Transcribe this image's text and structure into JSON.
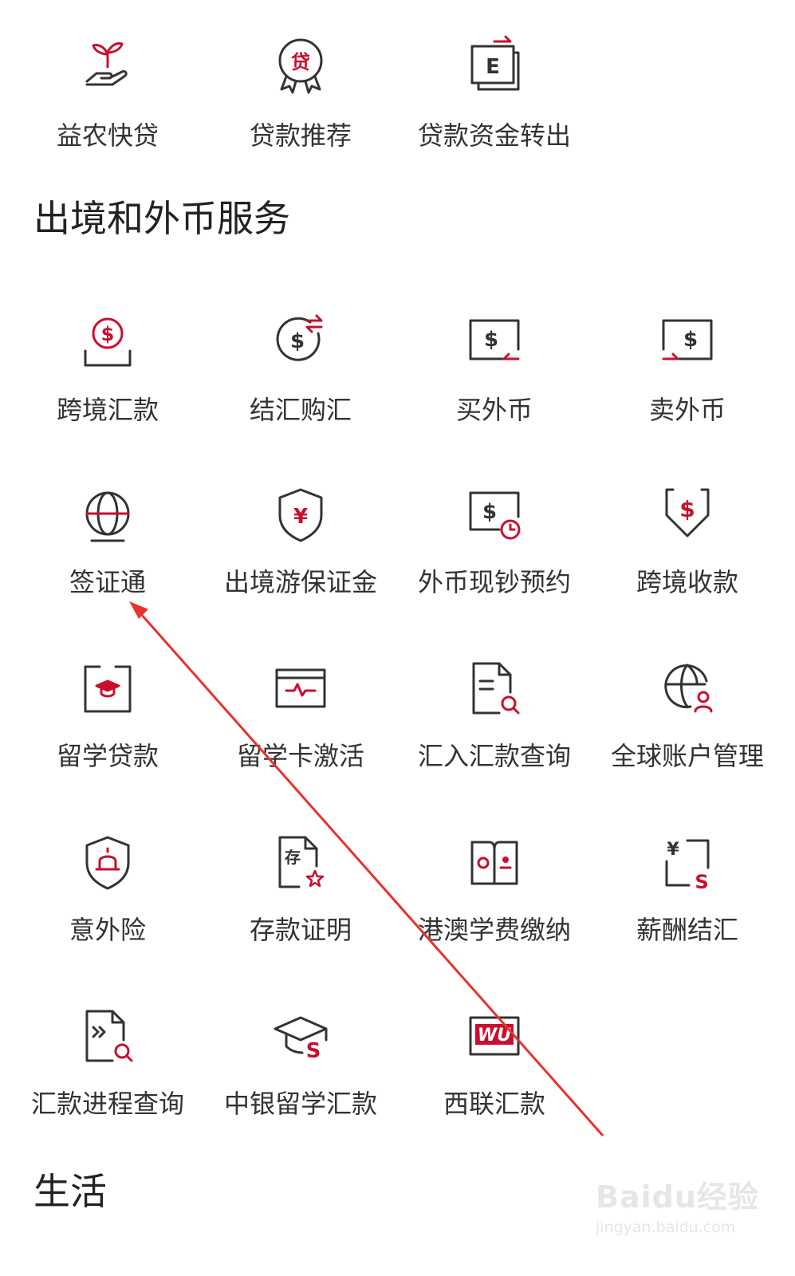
{
  "top_row": [
    {
      "label": "益农快贷",
      "icon": "seedling-hand-icon"
    },
    {
      "label": "贷款推荐",
      "icon": "loan-award-badge-icon"
    },
    {
      "label": "贷款资金转出",
      "icon": "e-transfer-icon"
    }
  ],
  "section_forex": {
    "title": "出境和外币服务",
    "items": [
      {
        "label": "跨境汇款",
        "icon": "dollar-coin-tray-icon"
      },
      {
        "label": "结汇购汇",
        "icon": "dollar-exchange-icon"
      },
      {
        "label": "买外币",
        "icon": "buy-dollar-icon"
      },
      {
        "label": "卖外币",
        "icon": "sell-dollar-icon"
      },
      {
        "label": "签证通",
        "icon": "globe-icon"
      },
      {
        "label": "出境游保证金",
        "icon": "yen-shield-icon"
      },
      {
        "label": "外币现钞预约",
        "icon": "cash-clock-icon"
      },
      {
        "label": "跨境收款",
        "icon": "dollar-download-icon"
      },
      {
        "label": "留学贷款",
        "icon": "graduation-book-icon"
      },
      {
        "label": "留学卡激活",
        "icon": "card-activate-icon"
      },
      {
        "label": "汇入汇款查询",
        "icon": "document-search-icon"
      },
      {
        "label": "全球账户管理",
        "icon": "globe-user-icon"
      },
      {
        "label": "意外险",
        "icon": "alarm-shield-icon"
      },
      {
        "label": "存款证明",
        "icon": "deposit-certificate-icon"
      },
      {
        "label": "港澳学费缴纳",
        "icon": "hk-macau-flags-icon"
      },
      {
        "label": "薪酬结汇",
        "icon": "yen-to-dollar-icon"
      },
      {
        "label": "汇款进程查询",
        "icon": "remittance-progress-icon"
      },
      {
        "label": "中银留学汇款",
        "icon": "graduation-cap-dollar-icon"
      },
      {
        "label": "西联汇款",
        "icon": "western-union-icon"
      }
    ]
  },
  "section_life": {
    "title": "生活"
  },
  "watermark": {
    "logo": "Baidu经验",
    "url": "jingyan.baidu.com"
  },
  "colors": {
    "accent": "#c8102e",
    "icon_stroke": "#333333",
    "text": "#333333",
    "annotation_arrow": "#e8322b"
  }
}
